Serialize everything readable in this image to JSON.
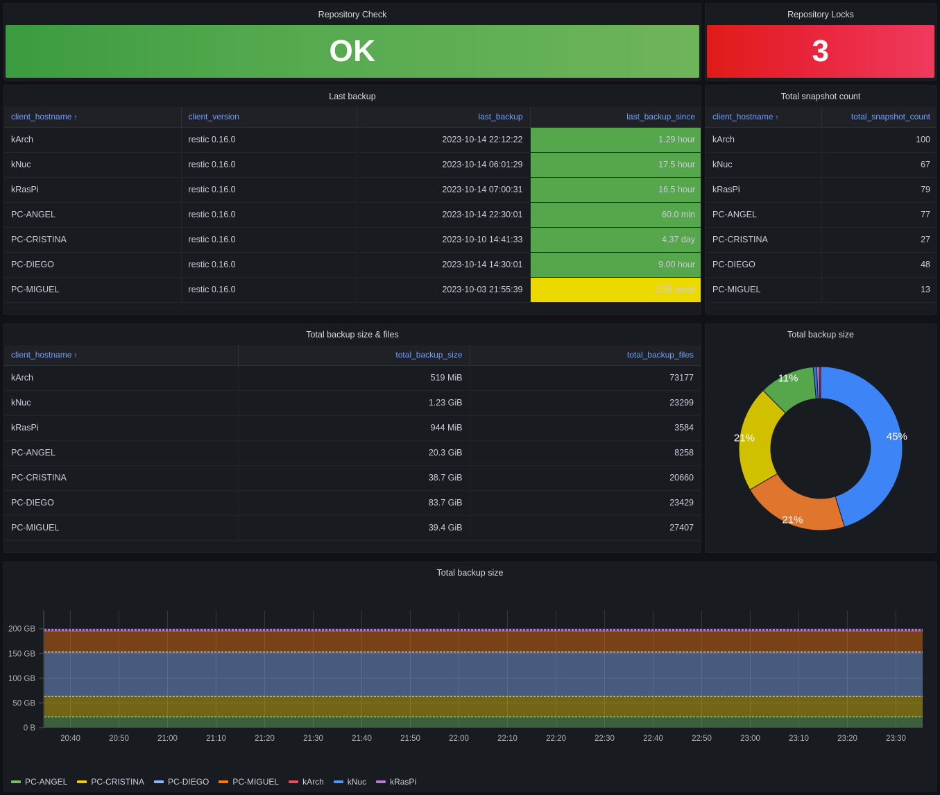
{
  "panels": {
    "repository_check": {
      "title": "Repository Check",
      "value": "OK",
      "color": "#56a64b"
    },
    "repository_locks": {
      "title": "Repository Locks",
      "value": "3",
      "color": "#e02f44"
    },
    "last_backup": {
      "title": "Last backup",
      "columns": [
        "client_hostname",
        "client_version",
        "last_backup",
        "last_backup_since"
      ],
      "sort_column": "client_hostname",
      "sort_arrow": "↑",
      "rows": [
        {
          "client_hostname": "kArch",
          "client_version": "restic 0.16.0",
          "last_backup": "2023-10-14 22:12:22",
          "last_backup_since": "1.29 hour",
          "since_color": "#56a64b"
        },
        {
          "client_hostname": "kNuc",
          "client_version": "restic 0.16.0",
          "last_backup": "2023-10-14 06:01:29",
          "last_backup_since": "17.5 hour",
          "since_color": "#56a64b"
        },
        {
          "client_hostname": "kRasPi",
          "client_version": "restic 0.16.0",
          "last_backup": "2023-10-14 07:00:31",
          "last_backup_since": "16.5 hour",
          "since_color": "#56a64b"
        },
        {
          "client_hostname": "PC-ANGEL",
          "client_version": "restic 0.16.0",
          "last_backup": "2023-10-14 22:30:01",
          "last_backup_since": "60.0 min",
          "since_color": "#56a64b"
        },
        {
          "client_hostname": "PC-CRISTINA",
          "client_version": "restic 0.16.0",
          "last_backup": "2023-10-10 14:41:33",
          "last_backup_since": "4.37 day",
          "since_color": "#56a64b"
        },
        {
          "client_hostname": "PC-DIEGO",
          "client_version": "restic 0.16.0",
          "last_backup": "2023-10-14 14:30:01",
          "last_backup_since": "9.00 hour",
          "since_color": "#56a64b"
        },
        {
          "client_hostname": "PC-MIGUEL",
          "client_version": "restic 0.16.0",
          "last_backup": "2023-10-03 21:55:39",
          "last_backup_since": "1.58 week",
          "since_color": "#ecd900"
        }
      ]
    },
    "snapshot_count": {
      "title": "Total snapshot count",
      "columns": [
        "client_hostname",
        "total_snapshot_count"
      ],
      "sort_column": "client_hostname",
      "sort_arrow": "↑",
      "rows": [
        {
          "client_hostname": "kArch",
          "total_snapshot_count": "100"
        },
        {
          "client_hostname": "kNuc",
          "total_snapshot_count": "67"
        },
        {
          "client_hostname": "kRasPi",
          "total_snapshot_count": "79"
        },
        {
          "client_hostname": "PC-ANGEL",
          "total_snapshot_count": "77"
        },
        {
          "client_hostname": "PC-CRISTINA",
          "total_snapshot_count": "27"
        },
        {
          "client_hostname": "PC-DIEGO",
          "total_snapshot_count": "48"
        },
        {
          "client_hostname": "PC-MIGUEL",
          "total_snapshot_count": "13"
        }
      ]
    },
    "backup_size_files": {
      "title": "Total backup size & files",
      "columns": [
        "client_hostname",
        "total_backup_size",
        "total_backup_files"
      ],
      "sort_column": "client_hostname",
      "sort_arrow": "↑",
      "rows": [
        {
          "client_hostname": "kArch",
          "total_backup_size": "519 MiB",
          "total_backup_files": "73177"
        },
        {
          "client_hostname": "kNuc",
          "total_backup_size": "1.23 GiB",
          "total_backup_files": "23299"
        },
        {
          "client_hostname": "kRasPi",
          "total_backup_size": "944 MiB",
          "total_backup_files": "3584"
        },
        {
          "client_hostname": "PC-ANGEL",
          "total_backup_size": "20.3 GiB",
          "total_backup_files": "8258"
        },
        {
          "client_hostname": "PC-CRISTINA",
          "total_backup_size": "38.7 GiB",
          "total_backup_files": "20660"
        },
        {
          "client_hostname": "PC-DIEGO",
          "total_backup_size": "83.7 GiB",
          "total_backup_files": "23429"
        },
        {
          "client_hostname": "PC-MIGUEL",
          "total_backup_size": "39.4 GiB",
          "total_backup_files": "27407"
        }
      ]
    },
    "backup_size_pie": {
      "title": "Total backup size"
    },
    "backup_size_ts": {
      "title": "Total backup size"
    }
  },
  "chart_data": [
    {
      "type": "pie",
      "title": "Total backup size",
      "donut": true,
      "legend": "none",
      "labels": [
        "PC-DIEGO",
        "PC-MIGUEL",
        "PC-CRISTINA",
        "PC-ANGEL",
        "kNuc",
        "kRasPi",
        "kArch"
      ],
      "values": [
        83.7,
        39.4,
        38.7,
        20.3,
        1.23,
        0.944,
        0.519
      ],
      "unit": "GiB",
      "percent_labels": [
        "45%",
        "21%",
        "21%",
        "11%",
        "",
        "",
        ""
      ],
      "colors": [
        "#3d85f7",
        "#e0752d",
        "#d1c000",
        "#56a64b",
        "#3274d9",
        "#b877d9",
        "#e0343f"
      ]
    },
    {
      "type": "area",
      "stacked": true,
      "title": "Total backup size",
      "xlabel": "",
      "ylabel": "",
      "ylim": [
        0,
        215
      ],
      "yticks": [
        "0 B",
        "50 GB",
        "100 GB",
        "150 GB",
        "200 GB"
      ],
      "ytick_values": [
        0,
        50,
        100,
        150,
        200
      ],
      "xticks": [
        "20:40",
        "20:50",
        "21:00",
        "21:10",
        "21:20",
        "21:30",
        "21:40",
        "21:50",
        "22:00",
        "22:10",
        "22:20",
        "22:30",
        "22:40",
        "22:50",
        "23:00",
        "23:10",
        "23:20",
        "23:30"
      ],
      "grid": true,
      "legend_position": "bottom",
      "series": [
        {
          "name": "PC-ANGEL",
          "color": "#73bf69",
          "value": 21.8
        },
        {
          "name": "PC-CRISTINA",
          "color": "#f2cc0c",
          "value": 41.5
        },
        {
          "name": "PC-DIEGO",
          "color": "#8ab8ff",
          "value": 89.9
        },
        {
          "name": "PC-MIGUEL",
          "color": "#ff780a",
          "value": 42.3
        },
        {
          "name": "kArch",
          "color": "#f2495c",
          "value": 0.54
        },
        {
          "name": "kNuc",
          "color": "#5794f2",
          "value": 1.32
        },
        {
          "name": "kRasPi",
          "color": "#b877d9",
          "value": 0.99
        }
      ]
    }
  ]
}
